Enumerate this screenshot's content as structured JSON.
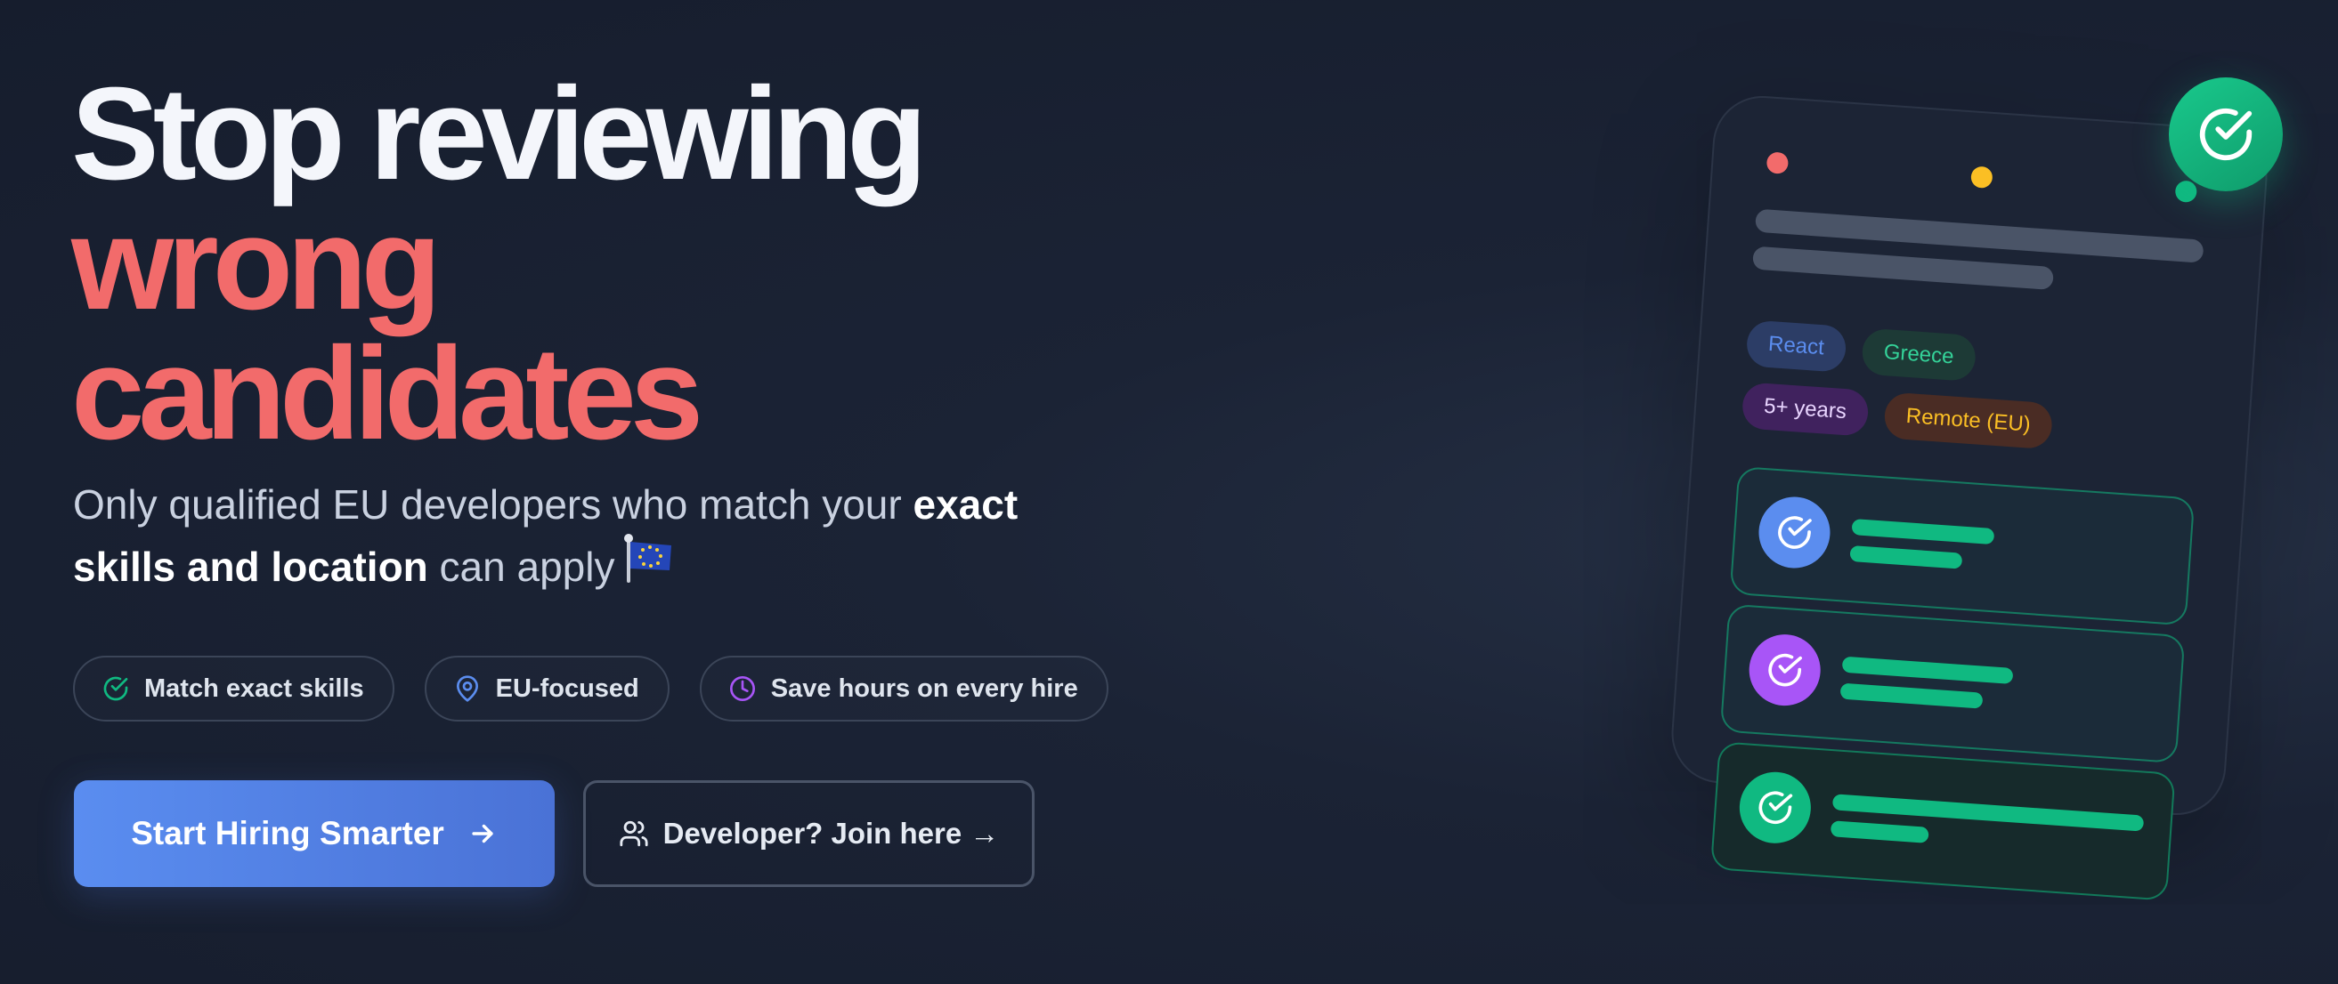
{
  "hero": {
    "title_line1": "Stop reviewing",
    "title_line2": "wrong",
    "title_line3": "candidates",
    "subtitle_part1": "Only qualified EU developers who match your ",
    "subtitle_bold1": "exact",
    "subtitle_bold2": "skills and location",
    "subtitle_part2": " can apply"
  },
  "features": [
    {
      "label": "Match exact skills",
      "icon": "check-circle-icon",
      "color": "#10b981"
    },
    {
      "label": "EU-focused",
      "icon": "map-pin-icon",
      "color": "#5b8def"
    },
    {
      "label": "Save hours on every hire",
      "icon": "clock-icon",
      "color": "#a855f7"
    }
  ],
  "cta": {
    "primary_label": "Start Hiring Smarter",
    "secondary_label": "Developer? Join here →"
  },
  "illustration": {
    "tags": [
      "React",
      "Greece",
      "5+ years",
      "Remote (EU)"
    ],
    "tag_colors": {
      "React": "#5b8def",
      "Greece": "#34d399",
      "5+ years": "#e9d5ff",
      "Remote (EU)": "#fbbf24"
    },
    "avatar_colors": [
      "#5b8def",
      "#a855f7",
      "#10b981"
    ]
  },
  "colors": {
    "background": "#1b2335",
    "accent_red": "#f26b6b",
    "primary_blue": "#5a8df0",
    "green": "#10b981"
  }
}
